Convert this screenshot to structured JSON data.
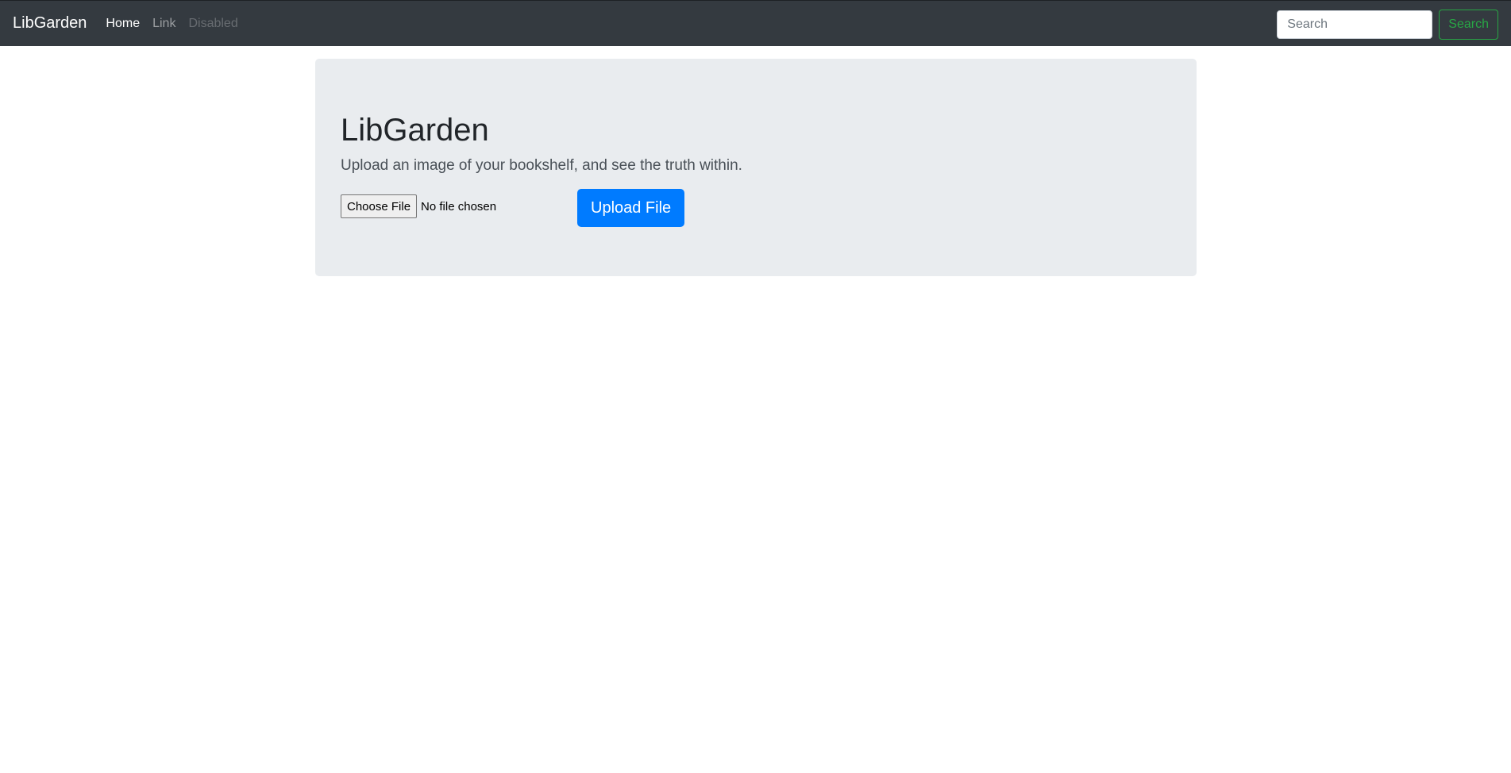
{
  "navbar": {
    "brand": "LibGarden",
    "links": [
      {
        "label": "Home",
        "state": "active"
      },
      {
        "label": "Link",
        "state": "normal"
      },
      {
        "label": "Disabled",
        "state": "disabled"
      }
    ],
    "search": {
      "placeholder": "Search",
      "value": "",
      "button_label": "Search"
    }
  },
  "jumbotron": {
    "title": "LibGarden",
    "lead": "Upload an image of your bookshelf, and see the truth within.",
    "file_input": {
      "button_label": "Choose File",
      "status": "No file chosen"
    },
    "upload_button_label": "Upload File"
  },
  "colors": {
    "navbar_bg": "#343a40",
    "jumbotron_bg": "#e9ecef",
    "primary": "#007bff",
    "success": "#28a745"
  }
}
